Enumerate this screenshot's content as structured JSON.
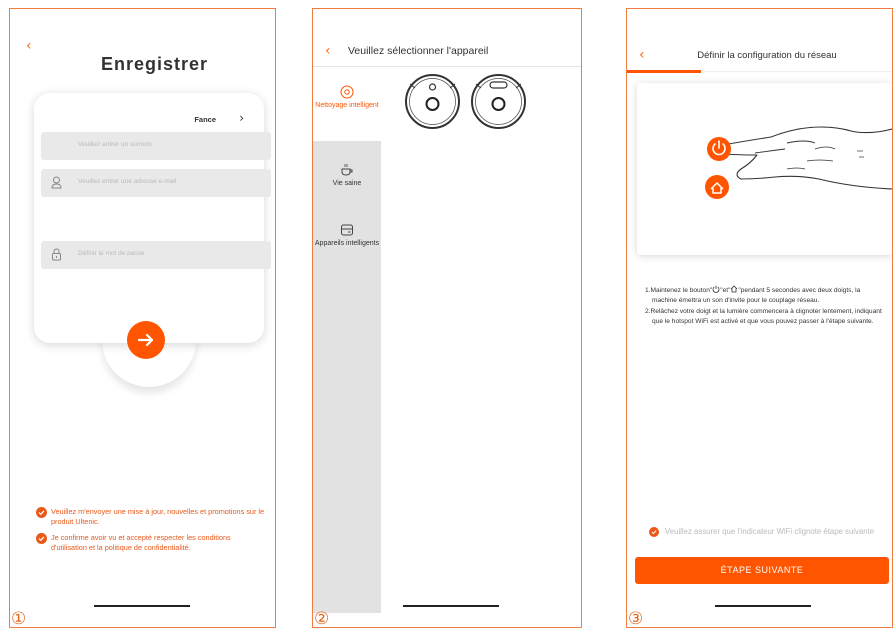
{
  "screen1": {
    "number": "①",
    "title": "Enregistrer",
    "country": "Fance",
    "nickname_placeholder": "Veuillez entrer un surnom",
    "email_placeholder": "Veuillez entrer une adresse e-mail",
    "password_placeholder": "Définir le mot de passe",
    "consents": [
      "Veuillez m'envoyer une mise à jour, nouvelles et promotions sur le produit Ultenic.",
      "Je confirme avoir vu et accepté respecter les conditions d'utilisation et la politique de confidentialité."
    ]
  },
  "screen2": {
    "number": "②",
    "title": "Veuillez sélectionner l'appareil",
    "categories": [
      "Nettoyage intelligent",
      "Vie saine",
      "Appareils intelligents"
    ],
    "active_category": "Nettoyage intelligent"
  },
  "screen3": {
    "number": "③",
    "title": "Définir la configuration du réseau",
    "instruction_1a": "1.Maintenez le bouton\"",
    "instruction_1b": "\"et\"",
    "instruction_1c": "\"pendant 5 secondes avec deux doigts, la machine émettra un son d'invite pour le couplage réseau.",
    "instruction_2": "2.Relâchez votre doigt et la lumière commencera à clignoter lentement, indiquant que le hotspot WiFi est activé et que vous pouvez passer à l'étape suivante.",
    "indicator_text": "Veuillez assurer que l'indicateur WiFi clignote étape suivante",
    "next_button": "ÉTAPE SUIVANTE"
  },
  "colors": {
    "accent": "#ff5500",
    "consent_text": "#e8591a",
    "panel_border": "#ee7d3e",
    "sidebar": "#e2e2e2"
  }
}
